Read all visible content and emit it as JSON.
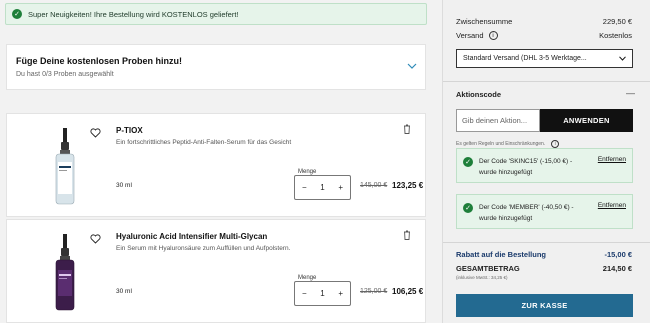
{
  "banner": {
    "text": "Super Neuigkeiten! Ihre Bestellung wird KOSTENLOS geliefert!"
  },
  "samples": {
    "title": "Füge Deine kostenlosen Proben hinzu!",
    "subtitle": "Du hast 0/3 Proben ausgewählt"
  },
  "products": [
    {
      "name": "P-TIOX",
      "description": "Ein fortschrittliches Peptid-Anti-Falten-Serum für das Gesicht",
      "size": "30 ml",
      "qty_label": "Menge",
      "qty": "1",
      "old_price": "145,00 €",
      "price": "123,25 €"
    },
    {
      "name": "Hyaluronic Acid Intensifier Multi-Glycan",
      "description": "Ein Serum mit Hyaluronsäure zum Auffüllen und Aufpolstern.",
      "size": "30 ml",
      "qty_label": "Menge",
      "qty": "1",
      "old_price": "125,00 €",
      "price": "106,25 €"
    }
  ],
  "summary": {
    "subtotal_label": "Zwischensumme",
    "subtotal_value": "229,50 €",
    "shipping_label": "Versand",
    "shipping_value": "Kostenlos",
    "shipping_option": "Standard Versand (DHL 3-5 Werktage...",
    "coupon_title": "Aktionscode",
    "coupon_placeholder": "Gib deinen Aktion...",
    "apply_label": "ANWENDEN",
    "rules_text": "Es gelten Regeln und Einschränkungen.",
    "codes": [
      {
        "line1": "Der Code 'SKINC15' (-15,00 €) -",
        "line2": "wurde hinzugefügt",
        "remove": "Entfernen"
      },
      {
        "line1": "Der Code 'MEMBER' (-40,50 €) -",
        "line2": "wurde hinzugefügt",
        "remove": "Entfernen"
      }
    ],
    "discount_label": "Rabatt auf die Bestellung",
    "discount_value": "-15,00 €",
    "total_label": "GESAMTBETRAG",
    "total_value": "214,50 €",
    "vat_text": "(inklusive MwSt.: 34,25 €)",
    "checkout_label": "ZUR KASSE"
  },
  "colors": {
    "accent": "#236a91",
    "success": "#1e7f3a",
    "success_bg": "#e6f4ea",
    "discount": "#1a3a6b"
  }
}
